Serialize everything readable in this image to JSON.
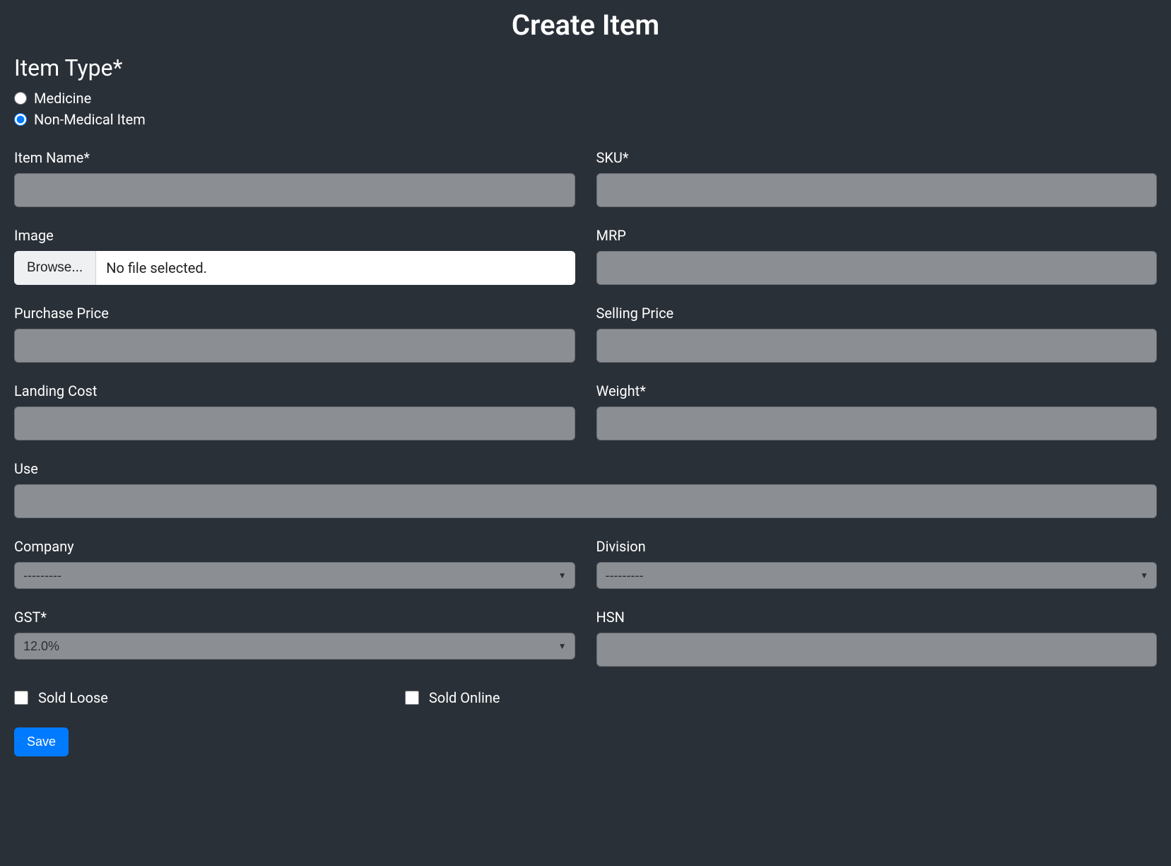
{
  "page": {
    "title": "Create Item"
  },
  "item_type": {
    "heading": "Item Type*",
    "options": {
      "medicine": {
        "label": "Medicine",
        "checked": false
      },
      "non_medical": {
        "label": "Non-Medical Item",
        "checked": true
      }
    }
  },
  "fields": {
    "item_name": {
      "label": "Item Name*",
      "value": ""
    },
    "sku": {
      "label": "SKU*",
      "value": ""
    },
    "image": {
      "label": "Image",
      "browse_label": "Browse...",
      "status": "No file selected."
    },
    "mrp": {
      "label": "MRP",
      "value": ""
    },
    "purchase_price": {
      "label": "Purchase Price",
      "value": ""
    },
    "selling_price": {
      "label": "Selling Price",
      "value": ""
    },
    "landing_cost": {
      "label": "Landing Cost",
      "value": ""
    },
    "weight": {
      "label": "Weight*",
      "value": ""
    },
    "use": {
      "label": "Use",
      "value": ""
    },
    "company": {
      "label": "Company",
      "selected": "---------"
    },
    "division": {
      "label": "Division",
      "selected": "---------"
    },
    "gst": {
      "label": "GST*",
      "selected": "12.0%"
    },
    "hsn": {
      "label": "HSN",
      "value": ""
    }
  },
  "checkboxes": {
    "sold_loose": {
      "label": "Sold Loose",
      "checked": false
    },
    "sold_online": {
      "label": "Sold Online",
      "checked": false
    }
  },
  "actions": {
    "save": "Save"
  }
}
